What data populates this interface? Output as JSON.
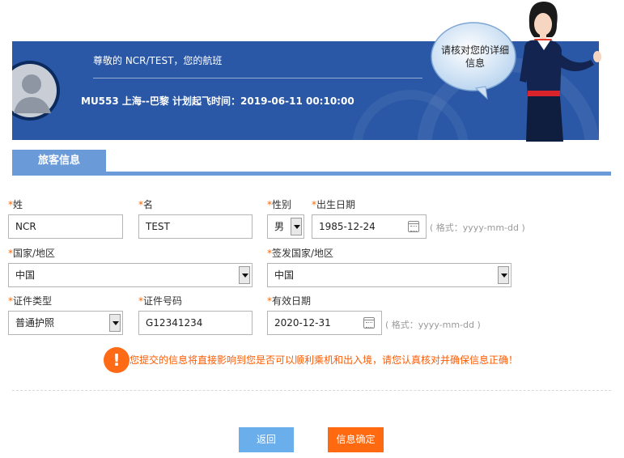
{
  "header": {
    "greeting": "尊敬的 NCR/TEST，您的航班",
    "flight_info": "MU553 上海--巴黎 计划起飞时间：2019-06-11 00:10:00",
    "bubble_text": "请核对您的详细信息"
  },
  "tabs": [
    {
      "label": "旅客信息"
    }
  ],
  "form": {
    "required_mark": "*",
    "surname": {
      "label": "姓",
      "value": "NCR"
    },
    "given_name": {
      "label": "名",
      "value": "TEST"
    },
    "gender": {
      "label": "性别",
      "value": "男"
    },
    "birth_date": {
      "label": "出生日期",
      "value": "1985-12-24",
      "hint": "( 格式：yyyy-mm-dd )"
    },
    "country": {
      "label": "国家/地区",
      "value": "中国"
    },
    "issuing_country": {
      "label": "签发国家/地区",
      "value": "中国"
    },
    "id_type": {
      "label": "证件类型",
      "value": "普通护照"
    },
    "id_number": {
      "label": "证件号码",
      "value": "G12341234"
    },
    "expiry_date": {
      "label": "有效日期",
      "value": "2020-12-31",
      "hint": "( 格式：yyyy-mm-dd )"
    }
  },
  "warning": {
    "icon": "!",
    "text": "您提交的信息将直接影响到您是否可以顺利乘机和出入境，请您认真核对并确保信息正确！"
  },
  "buttons": {
    "back": "返回",
    "confirm": "信息确定"
  },
  "colors": {
    "banner": "#2a58a6",
    "tab": "#6a9bd8",
    "required": "#ff6600",
    "warning": "#ff5a00",
    "back_button": "#6aaeec",
    "confirm_button": "#ff6a10"
  }
}
